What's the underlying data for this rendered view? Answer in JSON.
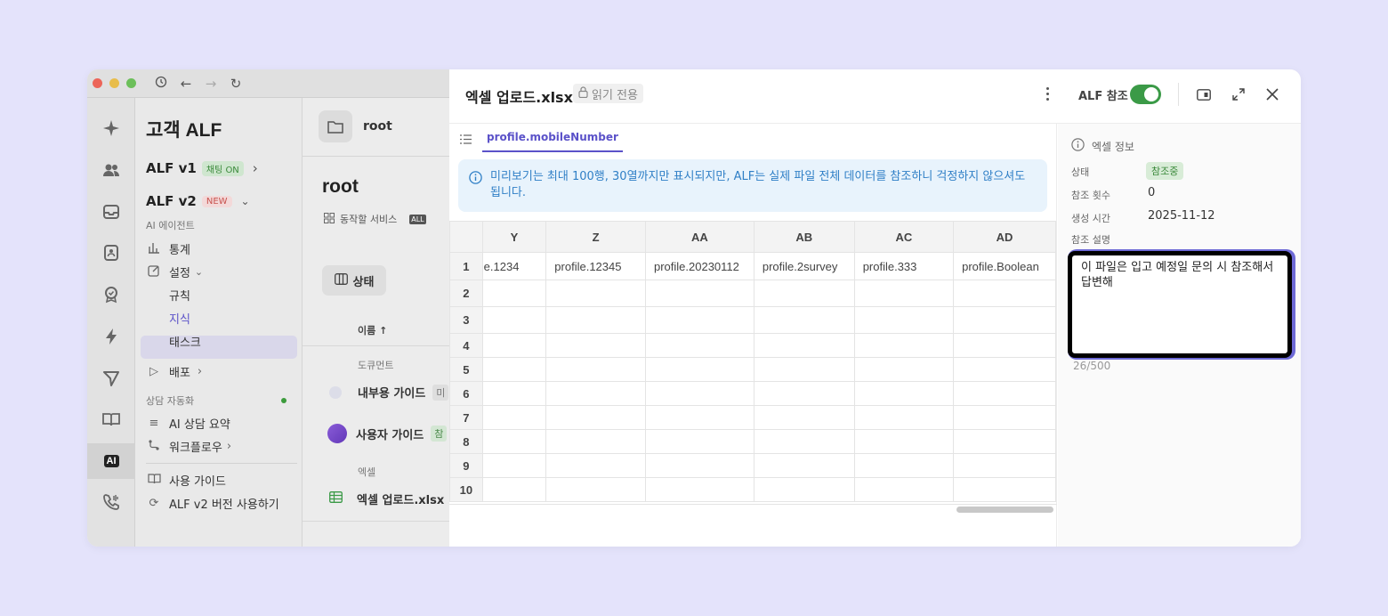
{
  "sidebar": {
    "title": "고객 ALF",
    "v1_label": "ALF v1",
    "v1_tag": "채팅 ON",
    "v2_label": "ALF v2",
    "v2_tag": "NEW",
    "section_agent": "AI 에이전트",
    "stats": "통계",
    "settings": "설정",
    "rules": "규칙",
    "knowledge": "지식",
    "task": "태스크",
    "deploy": "배포",
    "section_automation": "상담 자동화",
    "ai_summary": "AI 상담 요약",
    "workflow": "워크플로우",
    "guide": "사용 가이드",
    "use_v2": "ALF v2 버전 사용하기"
  },
  "content": {
    "breadcrumb": "root",
    "title": "root",
    "tab_service": "동작할 서비스",
    "tab_all": "ALL",
    "status_button": "상태",
    "col_name": "이름 ↑",
    "section_documents": "도큐먼트",
    "doc1": "내부용 가이드",
    "doc1_badge": "미",
    "doc2": "사용자 가이드",
    "doc2_badge": "참",
    "section_excel": "엑셀",
    "excel1": "엑셀 업로드.xlsx"
  },
  "panel": {
    "file_title": "엑셀 업로드.xlsx",
    "readonly": "읽기 전용",
    "alf_ref": "ALF 참조",
    "alf_ref_on": true,
    "sheet_tab": "profile.mobileNumber",
    "notice": "미리보기는 최대 100행, 30열까지만 표시되지만, ALF는 실제 파일 전체 데이터를 참조하니 걱정하지 않으셔도 됩니다."
  },
  "grid": {
    "columns": [
      "Y",
      "Z",
      "AA",
      "AB",
      "AC",
      "AD"
    ],
    "row1": [
      "e.1234",
      "profile.12345",
      "profile.20230112",
      "profile.2survey",
      "profile.333",
      "profile.Boolean"
    ],
    "row_numbers": [
      "1",
      "2",
      "3",
      "4",
      "5",
      "6",
      "7",
      "8",
      "9",
      "10"
    ]
  },
  "info": {
    "heading": "엑셀 정보",
    "status_label": "상태",
    "status_value": "참조중",
    "ref_count_label": "참조 횟수",
    "ref_count_value": "0",
    "created_label": "생성 시간",
    "created_value": "2025-11-12",
    "desc_label": "참조 설명",
    "desc_value": "이 파일은 입고 예정일 문의 시 참조해서 답변해",
    "counter": "26/500"
  },
  "colors": {
    "accent": "#5b52c9",
    "toggle_on": "#3b9a47",
    "notice_bg": "#e8f3fc",
    "notice_text": "#2f7fc6",
    "background": "#e4e3fb"
  }
}
